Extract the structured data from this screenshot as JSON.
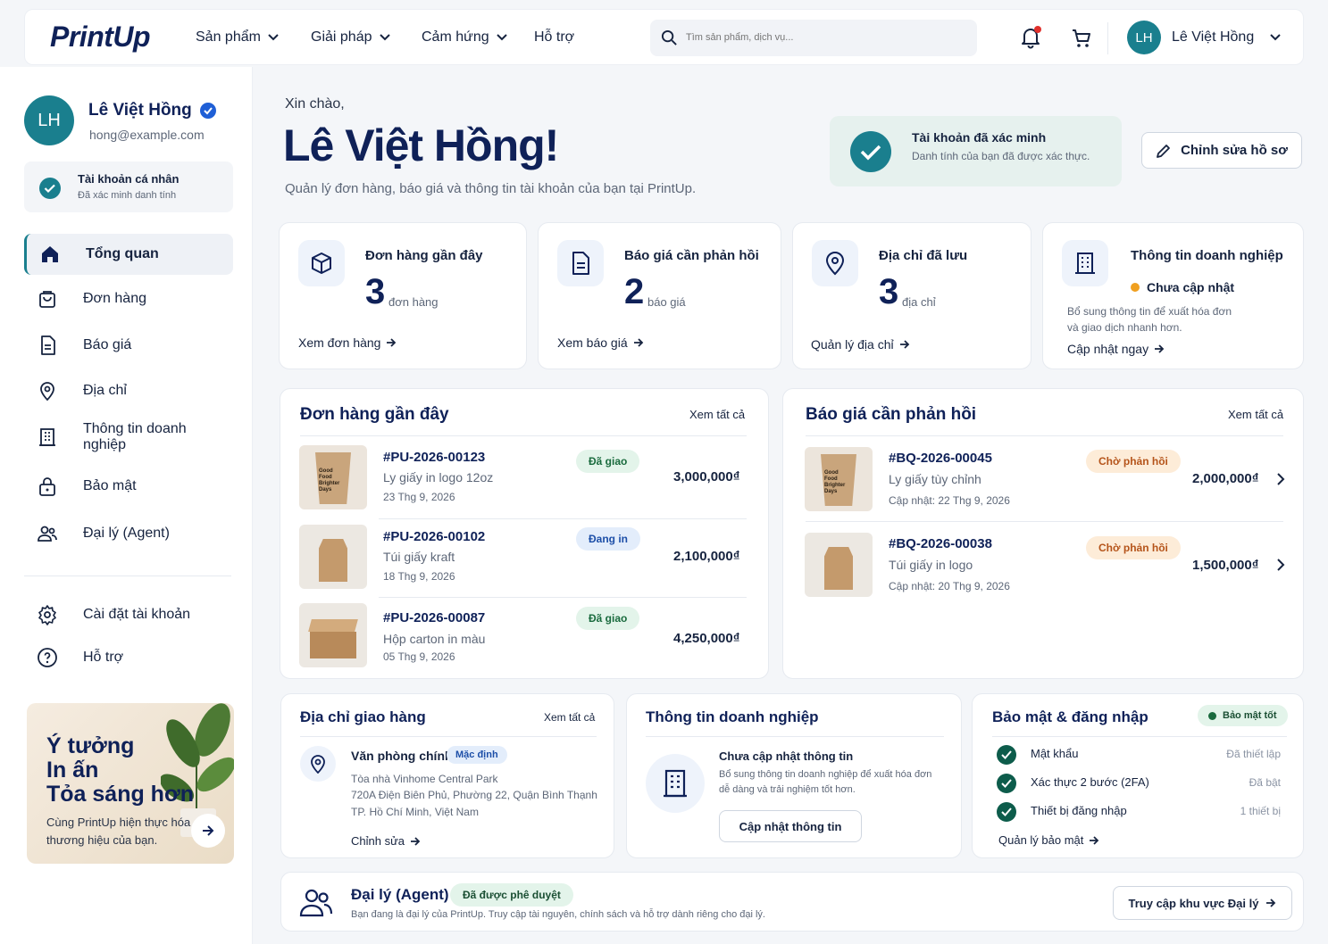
{
  "header": {
    "logo": "PrintUp",
    "nav": [
      "Sản phẩm",
      "Giải pháp",
      "Cảm hứng",
      "Hỗ trợ"
    ],
    "search_placeholder": "Tìm sản phẩm, dịch vụ...",
    "user_initials": "LH",
    "user_name": "Lê Việt Hồng"
  },
  "sidebar": {
    "initials": "LH",
    "name": "Lê Việt Hồng",
    "email": "hong@example.com",
    "account_title": "Tài khoản cá nhân",
    "account_sub": "Đã xác minh danh tính",
    "items": [
      "Tổng quan",
      "Đơn hàng",
      "Báo giá",
      "Địa chỉ",
      "Thông tin doanh nghiệp",
      "Bảo mật",
      "Đại lý (Agent)"
    ],
    "settings": "Cài đặt tài khoản",
    "help": "Hỗ trợ",
    "promo": {
      "line1": "Ý tưởng",
      "line2": "In ấn",
      "line3": "Tỏa sáng hơn",
      "sub1": "Cùng PrintUp hiện thực hóa",
      "sub2": "thương hiệu của bạn."
    }
  },
  "greeting": {
    "hello": "Xin chào,",
    "name": "Lê Việt Hồng!",
    "sub": "Quản lý đơn hàng, báo giá và thông tin tài khoản của bạn tại PrintUp."
  },
  "verified": {
    "title": "Tài khoản đã xác minh",
    "sub": "Danh tính của bạn đã được xác thực."
  },
  "edit_profile": "Chỉnh sửa hồ sơ",
  "stats": [
    {
      "title": "Đơn hàng gần đây",
      "value": "3",
      "unit": "đơn hàng",
      "link": "Xem đơn hàng"
    },
    {
      "title": "Báo giá cần phản hồi",
      "value": "2",
      "unit": "báo giá",
      "link": "Xem báo giá"
    },
    {
      "title": "Địa chỉ đã lưu",
      "value": "3",
      "unit": "địa chỉ",
      "link": "Quản lý địa chỉ"
    }
  ],
  "business_stat": {
    "title": "Thông tin doanh nghiệp",
    "status": "Chưa cập nhật",
    "desc1": "Bổ sung thông tin để xuất hóa đơn",
    "desc2": "và giao dịch nhanh hơn.",
    "link": "Cập nhật ngay"
  },
  "orders": {
    "title": "Đơn hàng gần đây",
    "view_all": "Xem tất cả",
    "rows": [
      {
        "id": "#PU-2026-00123",
        "name": "Ly giấy in logo 12oz",
        "date": "23 Thg 9, 2026",
        "status": "Đã giao",
        "amount": "3,000,000₫"
      },
      {
        "id": "#PU-2026-00102",
        "name": "Túi giấy kraft",
        "date": "18 Thg 9, 2026",
        "status": "Đang in",
        "amount": "2,100,000₫"
      },
      {
        "id": "#PU-2026-00087",
        "name": "Hộp carton in màu",
        "date": "05 Thg 9, 2026",
        "status": "Đã giao",
        "amount": "4,250,000₫"
      }
    ]
  },
  "quotes": {
    "title": "Báo giá cần phản hồi",
    "view_all": "Xem tất cả",
    "rows": [
      {
        "id": "#BQ-2026-00045",
        "name": "Ly giấy tùy chỉnh",
        "updated": "Cập nhật: 22 Thg 9, 2026",
        "status": "Chờ phản hồi",
        "amount": "2,000,000₫"
      },
      {
        "id": "#BQ-2026-00038",
        "name": "Túi giấy in logo",
        "updated": "Cập nhật: 20 Thg 9, 2026",
        "status": "Chờ phản hồi",
        "amount": "1,500,000₫"
      }
    ]
  },
  "cup_text": [
    "Good",
    "Food",
    "Brighter",
    "Days"
  ],
  "address": {
    "title": "Địa chỉ giao hàng",
    "view_all": "Xem tất cả",
    "name": "Văn phòng chính",
    "badge": "Mặc định",
    "line1": "Tòa nhà Vinhome Central Park",
    "line2": "720A Điện Biên Phủ, Phường 22, Quận Bình Thạnh",
    "line3": "TP. Hồ Chí Minh, Việt Nam",
    "edit": "Chỉnh sửa"
  },
  "business": {
    "title": "Thông tin doanh nghiệp",
    "heading": "Chưa cập nhật thông tin",
    "desc1": "Bổ sung thông tin doanh nghiệp để xuất hóa đơn",
    "desc2": "dễ dàng và trải nghiệm tốt hơn.",
    "button": "Cập nhật thông tin"
  },
  "security": {
    "title": "Bảo mật & đăng nhập",
    "badge": "Bảo mật tốt",
    "items": [
      {
        "label": "Mật khẩu",
        "value": "Đã thiết lập"
      },
      {
        "label": "Xác thực 2 bước (2FA)",
        "value": "Đã bật"
      },
      {
        "label": "Thiết bị đăng nhập",
        "value": "1 thiết bị"
      }
    ],
    "manage": "Quản lý bảo mật"
  },
  "agent": {
    "title": "Đại lý (Agent)",
    "badge": "Đã được phê duyệt",
    "desc": "Bạn đang là đại lý của PrintUp. Truy cập tài nguyên, chính sách và hỗ trợ dành riêng cho đại lý.",
    "button": "Truy cập khu vực Đại lý"
  },
  "colors": {
    "navy": "#0f2158",
    "teal": "#1a7f8e",
    "green": "#0d5c4b",
    "orange": "#f0a020",
    "notify_red": "#e0302c"
  }
}
